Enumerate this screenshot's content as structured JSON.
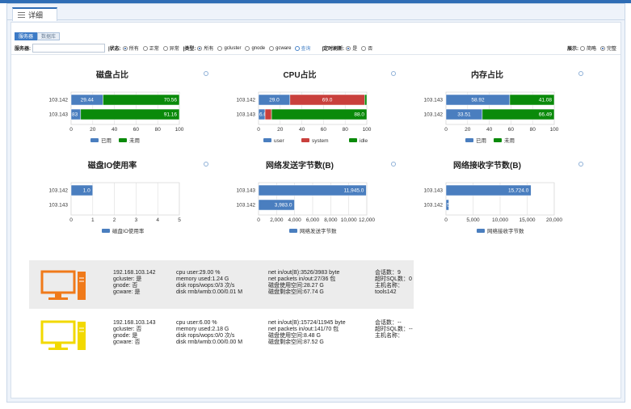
{
  "tab": {
    "label": "详细"
  },
  "subtabs": [
    "服务器",
    "数据库"
  ],
  "filter": {
    "server_label": "服务器:",
    "status_label": "|状态:",
    "status_options": [
      "所有",
      "正常",
      "异常"
    ],
    "type_label": "|类型:",
    "type_options": [
      "所有",
      "gcluster",
      "gnode",
      "gcware"
    ],
    "query_label": "查询",
    "refresh_label": "|定时刷新:",
    "refresh_options": [
      "是",
      "否"
    ],
    "display_label": "展示:",
    "display_options": [
      "简略",
      "完整"
    ]
  },
  "colors": {
    "used": "#4a7ebf",
    "free": "#0a8a0a",
    "system": "#c9403c",
    "accent": "#3d7bc6"
  },
  "chart_data": [
    {
      "type": "bar",
      "title": "磁盘占比",
      "categories": [
        "103.142",
        "103.143"
      ],
      "series": [
        {
          "name": "已用",
          "values": [
            29.44,
            8.83
          ]
        },
        {
          "name": "未用",
          "values": [
            70.56,
            91.16
          ]
        }
      ],
      "labels": [
        [
          "29.44",
          "70.56"
        ],
        [
          "83",
          "91.16"
        ]
      ],
      "xlim": [
        0,
        100
      ],
      "ticks": [
        "0",
        "20",
        "40",
        "60",
        "80",
        "100"
      ]
    },
    {
      "type": "bar",
      "title": "CPU占比",
      "categories": [
        "103.142",
        "103.143"
      ],
      "series": [
        {
          "name": "user",
          "values": [
            29.0,
            6.0
          ]
        },
        {
          "name": "system",
          "values": [
            69.0,
            6.0
          ]
        },
        {
          "name": "idle",
          "values": [
            2.0,
            88.0
          ]
        }
      ],
      "labels": [
        [
          "29.0",
          "69.0",
          ""
        ],
        [
          "6.0",
          "",
          "88.0"
        ]
      ],
      "xlim": [
        0,
        100
      ],
      "ticks": [
        "0",
        "20",
        "40",
        "60",
        "80",
        "100"
      ]
    },
    {
      "type": "bar",
      "title": "内存占比",
      "categories": [
        "103.143",
        "103.142"
      ],
      "series": [
        {
          "name": "已用",
          "values": [
            58.92,
            33.51
          ]
        },
        {
          "name": "未用",
          "values": [
            41.08,
            66.49
          ]
        }
      ],
      "labels": [
        [
          "58.92",
          "41.08"
        ],
        [
          "33.51",
          "66.49"
        ]
      ],
      "xlim": [
        0,
        100
      ],
      "ticks": [
        "0",
        "20",
        "40",
        "60",
        "80",
        "100"
      ]
    },
    {
      "type": "bar",
      "title": "磁盘IO使用率",
      "categories": [
        "103.142",
        "103.143"
      ],
      "series": [
        {
          "name": "磁盘IO使用率",
          "values": [
            1.0,
            0
          ]
        }
      ],
      "labels": [
        [
          "1.0"
        ],
        [
          ""
        ]
      ],
      "xlim": [
        0,
        5
      ],
      "ticks": [
        "0",
        "1",
        "2",
        "3",
        "4",
        "5"
      ]
    },
    {
      "type": "bar",
      "title": "网络发送字节数(B)",
      "categories": [
        "103.143",
        "103.142"
      ],
      "series": [
        {
          "name": "网络发送字节数",
          "values": [
            11945.0,
            3983.0
          ]
        }
      ],
      "labels": [
        [
          "11,945.0"
        ],
        [
          "3,983.0"
        ]
      ],
      "xlim": [
        0,
        12000
      ],
      "ticks": [
        "0",
        "2,000",
        "4,000",
        "6,000",
        "8,000",
        "10,000",
        "12,000"
      ]
    },
    {
      "type": "bar",
      "title": "网络接收字节数(B)",
      "categories": [
        "103.143",
        "103.142"
      ],
      "series": [
        {
          "name": "网络接收字节数",
          "values": [
            15724.0,
            526.0
          ]
        }
      ],
      "labels": [
        [
          "15,724.0"
        ],
        [
          "526.0"
        ]
      ],
      "xlim": [
        0,
        20000
      ],
      "ticks": [
        "0",
        "5,000",
        "10,000",
        "15,000",
        "20,000"
      ]
    }
  ],
  "servers": [
    {
      "icon_color": "#f07a1a",
      "col1": [
        "192.168.103.142",
        "gcluster: 是",
        "gnode: 否",
        "gcware: 是"
      ],
      "col2": [
        "cpu user:29.00 %",
        "memory used:1.24 G",
        "disk rops/wops:0/3 次/s",
        "disk rmb/wmb:0.00/0.01 M"
      ],
      "col3": [
        "net in/out(B):3526/3983 byte",
        "net packets in/out:27/36 包",
        "磁盘使用空间:28.27 G",
        "磁盘剩余空间:67.74 G"
      ],
      "col4": [
        "会话数：9",
        "超时SQL数：0",
        "主机名称：tools142"
      ]
    },
    {
      "icon_color": "#f2d900",
      "col1": [
        "192.168.103.143",
        "gcluster: 否",
        "gnode: 是",
        "gcware: 否"
      ],
      "col2": [
        "cpu user:6.00 %",
        "memory used:2.18 G",
        "disk rops/wops:0/0 次/s",
        "disk rmb/wmb:0.00/0.00 M"
      ],
      "col3": [
        "net in/out(B):15724/11945 byte",
        "net packets in/out:141/70 包",
        "磁盘使用空间:8.48 G",
        "磁盘剩余空间:87.52 G"
      ],
      "col4": [
        "会话数：--",
        "超时SQL数：--",
        "主机名称："
      ]
    }
  ]
}
